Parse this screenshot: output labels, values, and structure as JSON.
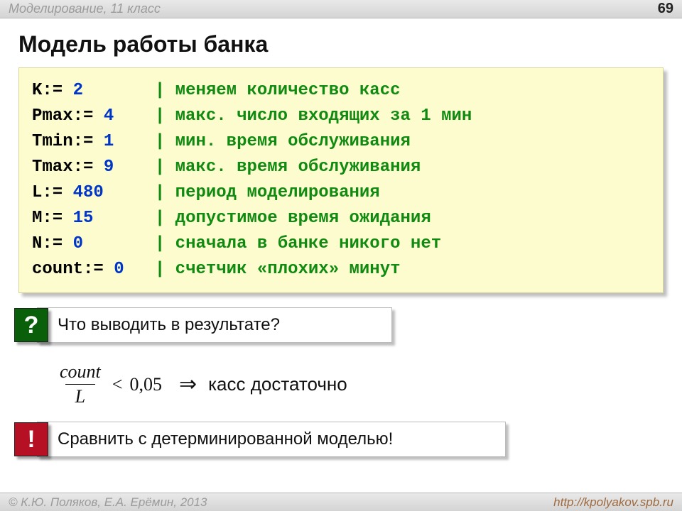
{
  "topbar": {
    "course": "Моделирование, 11 класс",
    "pagenum": "69"
  },
  "title": "Модель работы банка",
  "code": {
    "lines": [
      {
        "var": "K",
        "val": "2",
        "pad": "   ",
        "cmt": "| меняем количество касс"
      },
      {
        "var": "Pmax",
        "val": "4",
        "pad": "",
        "cmt": "| макс. число входящих за 1 мин"
      },
      {
        "var": "Tmin",
        "val": "1",
        "pad": "",
        "cmt": "| мин. время обслуживания"
      },
      {
        "var": "Tmax",
        "val": "9",
        "pad": "",
        "cmt": "| макс. время обслуживания"
      },
      {
        "var": "L",
        "val": "480",
        "pad": " ",
        "cmt": "| период моделирования"
      },
      {
        "var": "M",
        "val": "15",
        "pad": "  ",
        "cmt": "| допустимое время ожидания"
      },
      {
        "var": "N",
        "val": "0",
        "pad": "   ",
        "cmt": "| сначала в банке никого нет"
      },
      {
        "var": "count",
        "val": "0",
        "pad": "",
        "cmt": "| счетчик «плохих» минут"
      }
    ],
    "assign": ":= "
  },
  "question": {
    "badge": "?",
    "text": "Что выводить в результате?"
  },
  "formula": {
    "numerator": "count",
    "denominator": "L",
    "lt": "<",
    "threshold": "0,05",
    "arrow": "⇒",
    "conclusion": "касс достаточно"
  },
  "exclaim": {
    "badge": "!",
    "text": "Сравнить с детерминированной моделью!"
  },
  "footer": {
    "copyright": "© К.Ю. Поляков, Е.А. Ерёмин, 2013",
    "url": "http://kpolyakov.spb.ru"
  }
}
